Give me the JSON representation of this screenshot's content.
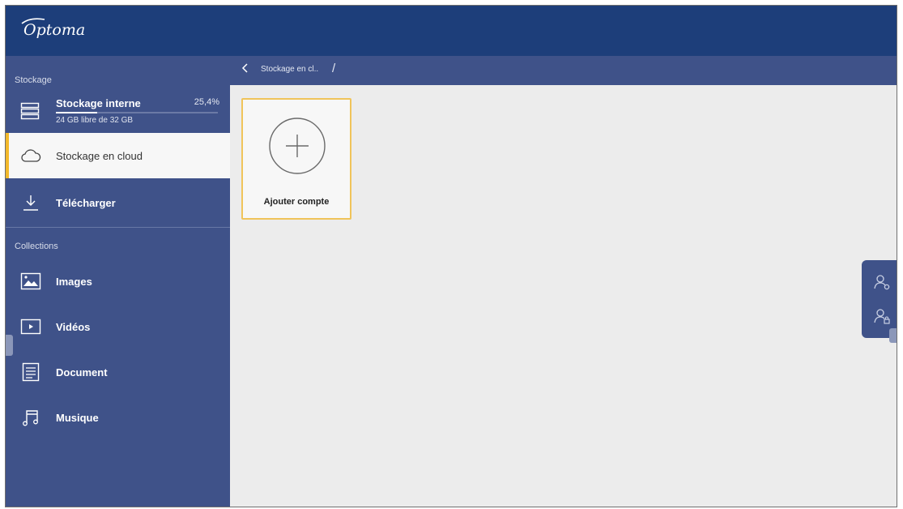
{
  "header": {
    "logo_text": "Optoma"
  },
  "sidebar": {
    "storage_section": "Stockage",
    "internal_storage": {
      "label": "Stockage interne",
      "percent_text": "25,4%",
      "used_fraction": 0.254,
      "detail": "24 GB libre de 32 GB"
    },
    "items": [
      {
        "label": "Stockage en cloud",
        "icon": "cloud-icon",
        "active": true
      },
      {
        "label": "Télécharger",
        "icon": "download-icon",
        "active": false
      }
    ],
    "collections_section": "Collections",
    "collections": [
      {
        "label": "Images",
        "icon": "image-icon"
      },
      {
        "label": "Vidéos",
        "icon": "video-icon"
      },
      {
        "label": "Document",
        "icon": "document-icon"
      },
      {
        "label": "Musique",
        "icon": "music-icon"
      }
    ]
  },
  "breadcrumb": {
    "back_icon": "chevron-left-icon",
    "current": "Stockage en cl..",
    "separator": "/"
  },
  "main": {
    "add_account": {
      "label": "Ajouter compte",
      "icon": "plus-circle-icon"
    }
  },
  "right_panel": {
    "icons": [
      "user-settings-icon",
      "user-lock-icon"
    ]
  },
  "colors": {
    "header": "#1d3e7a",
    "sidebar": "#3f5289",
    "accent": "#f3b92b",
    "card_border": "#f0c45a"
  }
}
